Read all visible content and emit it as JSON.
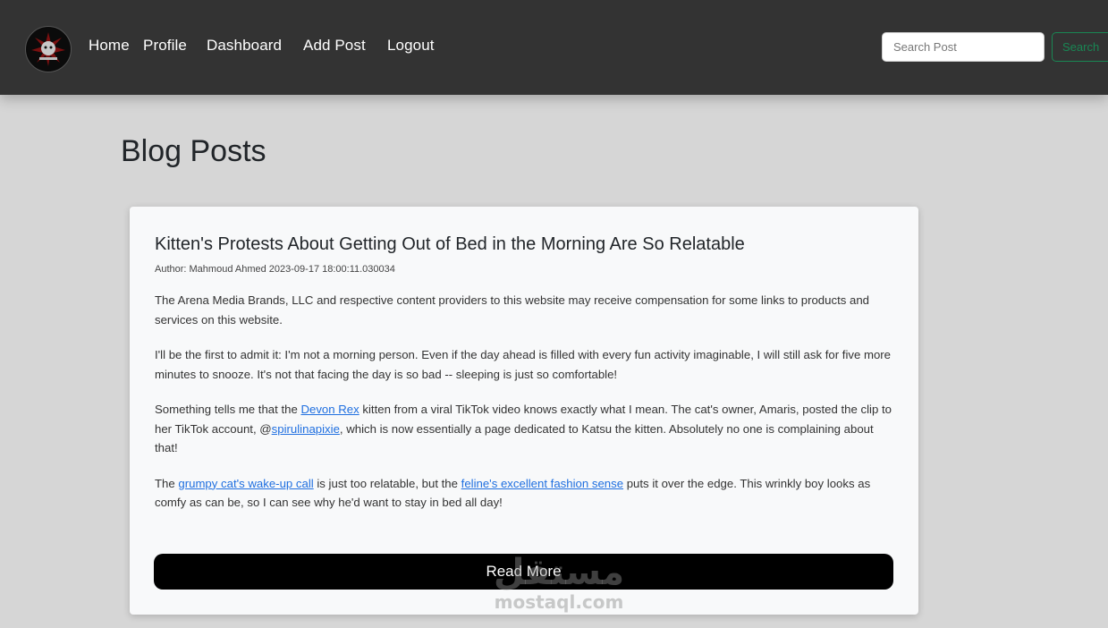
{
  "nav": {
    "logo_icon": "brand-logo-icon",
    "links": [
      "Home",
      "Profile",
      "Dashboard",
      "Add Post",
      "Logout"
    ],
    "search": {
      "placeholder": "Search Post",
      "button_label": "Search"
    }
  },
  "page": {
    "title": "Blog Posts"
  },
  "post": {
    "title": "Kitten's Protests About Getting Out of Bed in the Morning Are So Relatable",
    "meta": "Author: Mahmoud Ahmed 2023-09-17 18:00:11.030034",
    "p1": "The Arena Media Brands, LLC and respective content providers to this website may receive compensation for some links to products and services on this website.",
    "p2": "I'll be the first to admit it: I'm not a morning person. Even if the day ahead is filled with every fun activity imaginable, I will still ask for five more minutes to snooze. It's not that facing the day is so bad -- sleeping is just so comfortable!",
    "p3_a": "Something tells me that the ",
    "p3_link1": "Devon Rex",
    "p3_b": " kitten from a viral TikTok video knows exactly what I mean. The cat's owner, Amaris, posted the clip to her TikTok account, @",
    "p3_link2": "spirulinapixie",
    "p3_c": ", which is now essentially a page dedicated to Katsu the kitten. Absolutely no one is complaining about that!",
    "p4_a": "The ",
    "p4_link1": "grumpy cat's wake-up call",
    "p4_b": " is just too relatable, but the ",
    "p4_link2": "feline's excellent fashion sense",
    "p4_c": " puts it over the edge. This wrinkly boy looks as comfy as can be, so I can see why he'd want to stay in bed all day!",
    "read_more": "Read More"
  },
  "watermark": {
    "arabic": "مستقل",
    "latin": "mostaql.com"
  },
  "colors": {
    "navbar": "#333333",
    "search_accent": "#198754",
    "link": "#1f6fe0",
    "page_bg": "#d6d6d6"
  }
}
